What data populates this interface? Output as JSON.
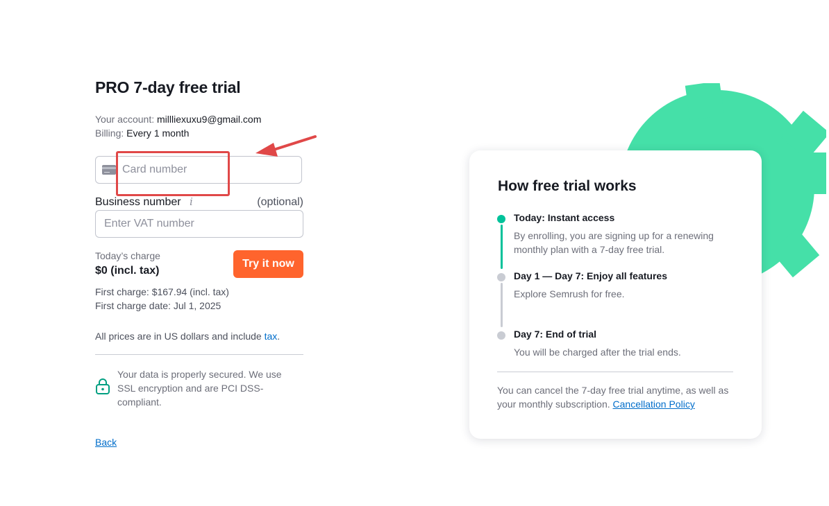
{
  "form": {
    "title": "PRO 7-day free trial",
    "account_label": "Your account:",
    "account_value": "millliexuxu9@gmail.com",
    "billing_label": "Billing:",
    "billing_value": "Every 1 month",
    "card_placeholder": "Card number",
    "business_label": "Business number",
    "business_info_glyph": "i",
    "business_optional": "(optional)",
    "vat_placeholder": "Enter VAT number",
    "today_charge_label": "Today’s charge",
    "today_charge_value": "$0 (incl. tax)",
    "try_button": "Try it now",
    "first_charge": "First charge: $167.94 (incl. tax)",
    "first_charge_date": "First charge date: Jul 1, 2025",
    "prices_text": "All prices are in US dollars and include",
    "tax_link": "tax",
    "prices_period": ".",
    "secure_text": "Your data is properly secured. We use SSL encryption and are PCI DSS-compliant.",
    "back_link": "Back"
  },
  "panel": {
    "title": "How free trial works",
    "steps": [
      {
        "title": "Today: Instant access",
        "desc": "By enrolling, you are signing up for a renewing monthly plan with a 7-day free trial.",
        "active": true
      },
      {
        "title": "Day 1 — Day 7: Enjoy all features",
        "desc": "Explore Semrush for free.",
        "active": false
      },
      {
        "title": "Day 7: End of trial",
        "desc": "You will be charged after the trial ends.",
        "active": false
      }
    ],
    "note": "You can cancel the 7-day free trial anytime, as well as your monthly subscription.",
    "policy_link": "Cancellation Policy"
  },
  "colors": {
    "accent_orange": "#ff642d",
    "accent_green": "#00c29a",
    "decor_green": "#45e0a8",
    "link_blue": "#006dca",
    "annotation_red": "#e04848"
  },
  "icons": [
    "credit-card-icon",
    "info-icon",
    "lock-icon",
    "annotation-arrow"
  ]
}
